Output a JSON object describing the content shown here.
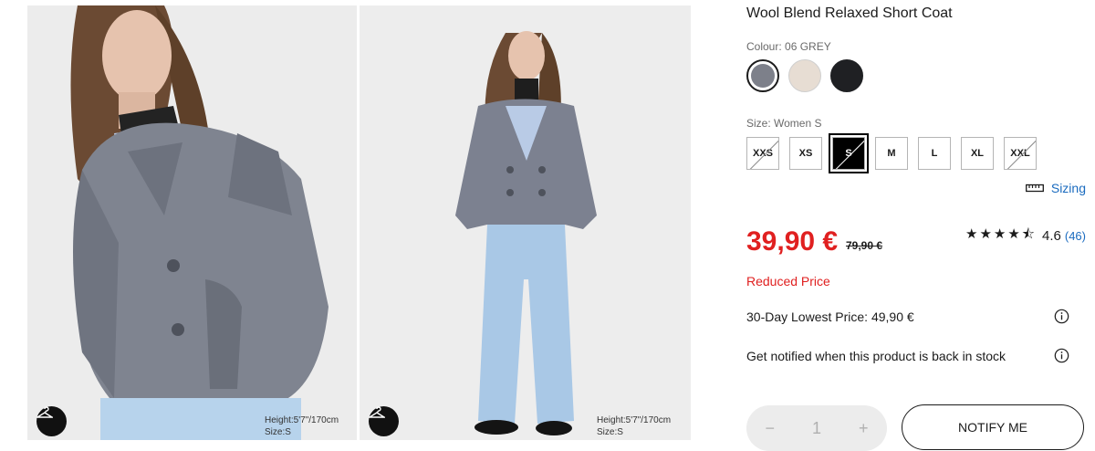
{
  "gallery": {
    "images": [
      {
        "height_text": "Height:5'7\"/170cm",
        "size_text": "Size:S"
      },
      {
        "height_text": "Height:5'7\"/170cm",
        "size_text": "Size:S"
      }
    ]
  },
  "product": {
    "title": "Wool Blend Relaxed Short Coat",
    "colour_label": "Colour: 06 GREY",
    "colours": [
      {
        "name": "grey",
        "hex": "#7d808a",
        "selected": true
      },
      {
        "name": "beige",
        "hex": "#e7ddd3",
        "selected": false
      },
      {
        "name": "black",
        "hex": "#1f2023",
        "selected": false
      }
    ],
    "size_label": "Size: Women S",
    "sizes": [
      {
        "label": "XXS",
        "available": false,
        "selected": false
      },
      {
        "label": "XS",
        "available": true,
        "selected": false
      },
      {
        "label": "S",
        "available": false,
        "selected": true
      },
      {
        "label": "M",
        "available": true,
        "selected": false
      },
      {
        "label": "L",
        "available": true,
        "selected": false
      },
      {
        "label": "XL",
        "available": true,
        "selected": false
      },
      {
        "label": "XXL",
        "available": false,
        "selected": false
      }
    ],
    "sizing_link": "Sizing",
    "price": "39,90 €",
    "old_price": "79,90 €",
    "rating": {
      "stars": "★★★★⯪",
      "value": "4.6",
      "count": "(46)"
    },
    "reduced_label": "Reduced Price",
    "lowest_price": "30-Day Lowest Price: 49,90 €",
    "stock_note": "Get notified when this product is back in stock",
    "quantity": {
      "minus": "−",
      "value": "1",
      "plus": "+"
    },
    "notify_button": "NOTIFY ME"
  },
  "colors": {
    "accent_red": "#e02020",
    "link_blue": "#1a6bbf"
  }
}
